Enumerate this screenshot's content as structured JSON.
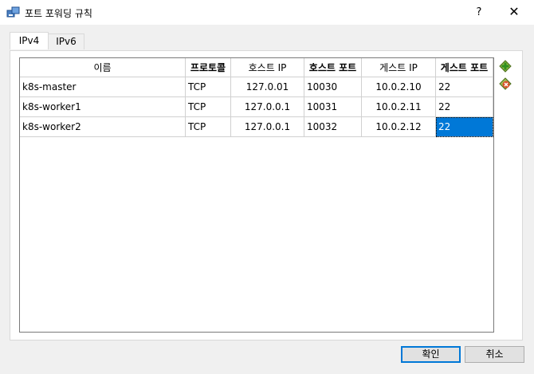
{
  "window": {
    "title": "포트 포워딩 규칙",
    "help": "?",
    "close": "✕"
  },
  "tabs": [
    {
      "label": "IPv4",
      "active": true
    },
    {
      "label": "IPv6",
      "active": false
    }
  ],
  "columns": [
    "이름",
    "프로토콜",
    "호스트 IP",
    "호스트 포트",
    "게스트 IP",
    "게스트 포트"
  ],
  "rows": [
    {
      "name": "k8s-master",
      "protocol": "TCP",
      "host_ip": "127.0.01",
      "host_port": "10030",
      "guest_ip": "10.0.2.10",
      "guest_port": "22"
    },
    {
      "name": "k8s-worker1",
      "protocol": "TCP",
      "host_ip": "127.0.0.1",
      "host_port": "10031",
      "guest_ip": "10.0.2.11",
      "guest_port": "22"
    },
    {
      "name": "k8s-worker2",
      "protocol": "TCP",
      "host_ip": "127.0.0.1",
      "host_port": "10032",
      "guest_ip": "10.0.2.12",
      "guest_port": "22"
    }
  ],
  "side_buttons": {
    "add": "add-rule-icon",
    "remove": "remove-rule-icon"
  },
  "buttons": {
    "ok": "확인",
    "cancel": "취소"
  },
  "colors": {
    "selection": "#0078d7",
    "add_icon": "#3ba32e",
    "remove_icon": "#d9532c"
  }
}
